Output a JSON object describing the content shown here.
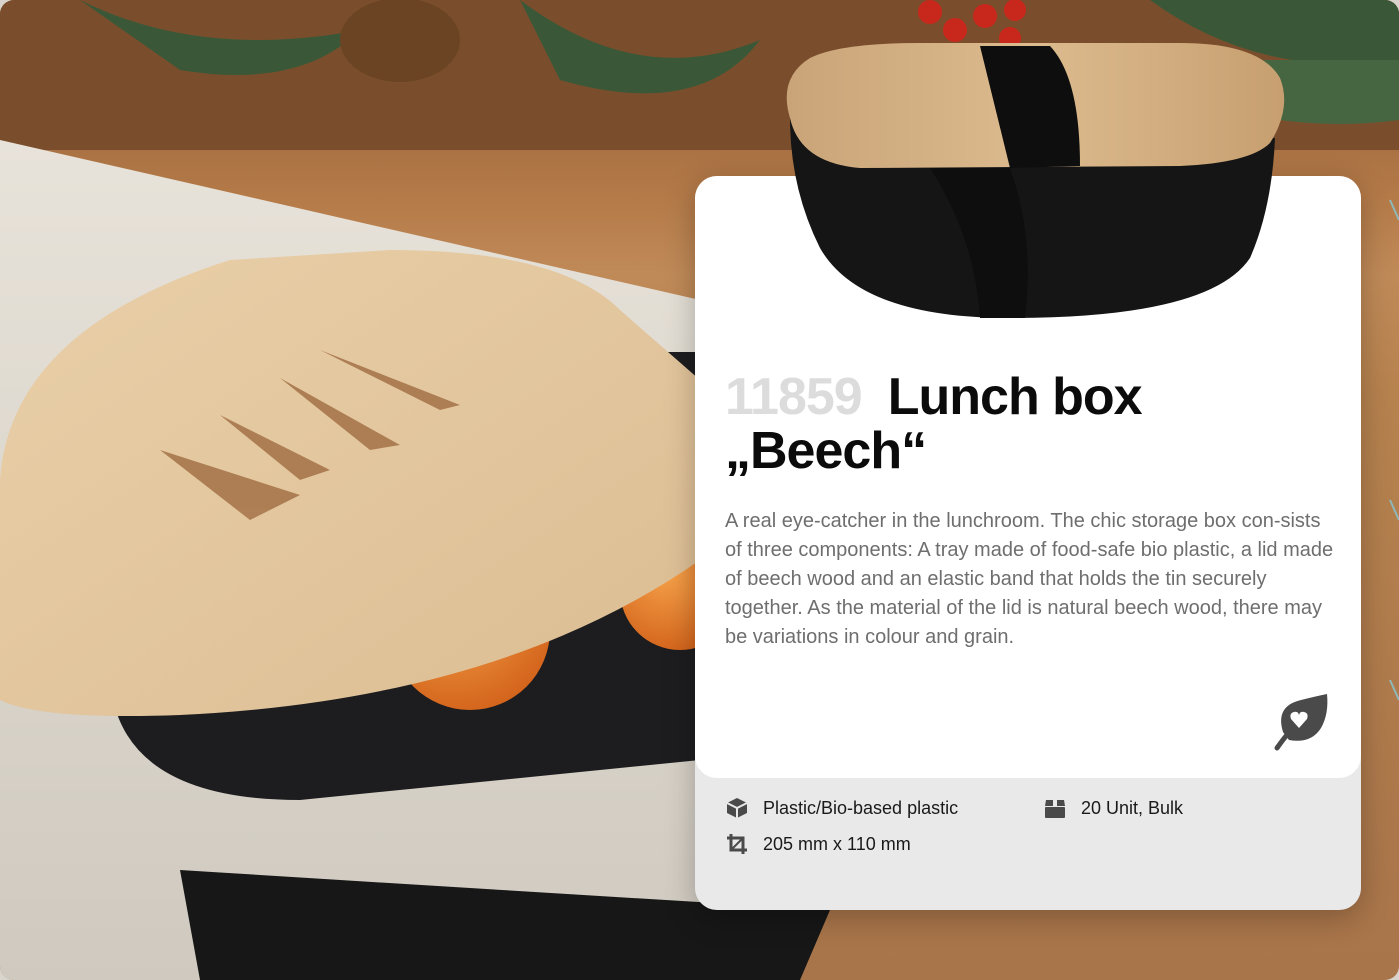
{
  "product": {
    "sku": "11859",
    "title": "Lunch box „Beech“",
    "description": "A real eye-catcher in the lunchroom. The chic storage box con-sists of three components: A tray made of food-safe bio plastic, a lid made of beech wood and an elastic band that holds the tin securely together. As the material of the lid is natural beech wood, there may be variations in colour and grain."
  },
  "specs": {
    "material": "Plastic/Bio-based plastic",
    "packaging": "20 Unit, Bulk",
    "dimensions": "205 mm x 110 mm"
  },
  "icons": {
    "material": "box-icon",
    "packaging": "package-icon",
    "dimensions": "crop-icon",
    "eco": "eco-leaf-heart-icon"
  },
  "colors": {
    "sku": "#dcdcdc",
    "title": "#0b0b0b",
    "description": "#6e6e6e",
    "icon": "#4a4a4a"
  }
}
